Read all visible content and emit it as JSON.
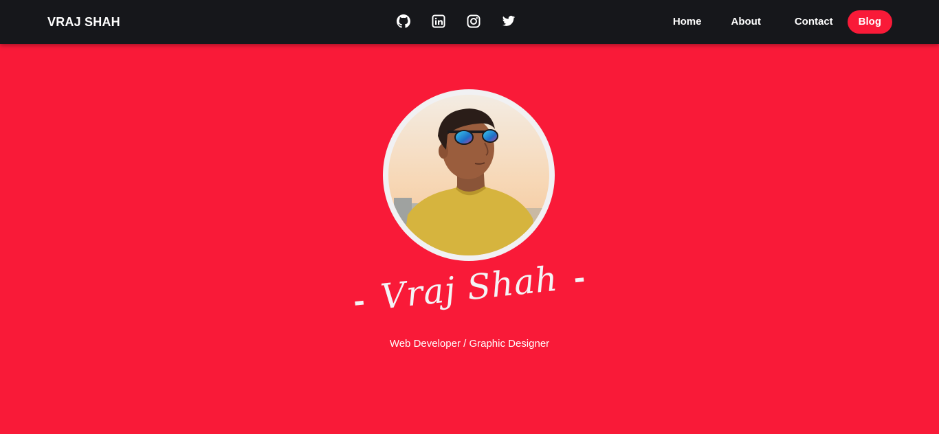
{
  "navbar": {
    "brand": "VRAJ SHAH",
    "social": [
      {
        "icon": "github-icon"
      },
      {
        "icon": "linkedin-icon"
      },
      {
        "icon": "instagram-icon"
      },
      {
        "icon": "twitter-icon"
      }
    ],
    "links": {
      "home": "Home",
      "about": "About",
      "contact": "Contact",
      "blog": "Blog"
    }
  },
  "hero": {
    "name_dash_left": "-",
    "name": "Vraj Shah",
    "name_dash_right": "-",
    "subtitle": "Web Developer / Graphic Designer"
  },
  "colors": {
    "accent": "#f91a38",
    "navbar_bg": "#16171b",
    "text": "#ffffff"
  }
}
